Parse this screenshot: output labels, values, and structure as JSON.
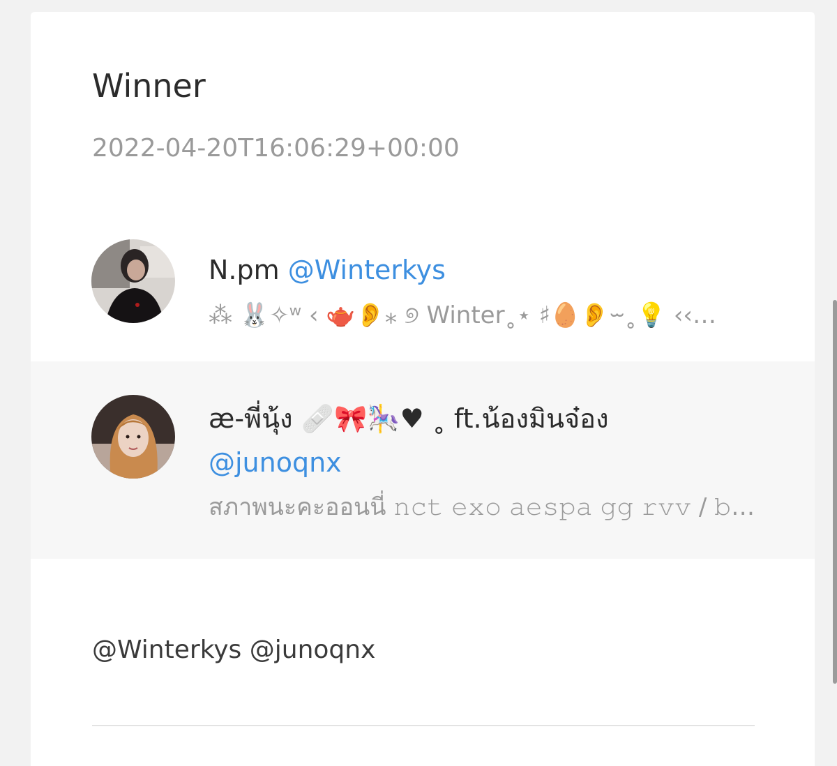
{
  "post": {
    "title": "Winner",
    "timestamp": "2022-04-20T16:06:29+00:00"
  },
  "entries": [
    {
      "name": "N.pm",
      "handle": "@Winterkys",
      "bio": "⁂ 🐰✧ʷ ‹ 🫖👂⁎ ୭ Winter˳⋆ ♯🥚👂⏖˳💡 ‹‹…"
    },
    {
      "name": "æ-พี่นุ้ง 🩹🎀🎠♥ ˳ ft.น้องมินจ๋อง",
      "handle": "@junoqnx",
      "bio": "สภาพนะคะออนนี่ 𝚗𝚌𝚝 𝚎𝚡𝚘 𝚊𝚎𝚜𝚙𝚊 𝚐𝚐 𝚛𝚟𝚟 / 𝚋𝚔𝚙𝚙 …"
    }
  ],
  "mentions": "@Winterkys @junoqnx",
  "colors": {
    "link": "#3d8fe0",
    "muted": "#9a9a9a",
    "background": "#f2f2f2",
    "card": "#ffffff"
  }
}
